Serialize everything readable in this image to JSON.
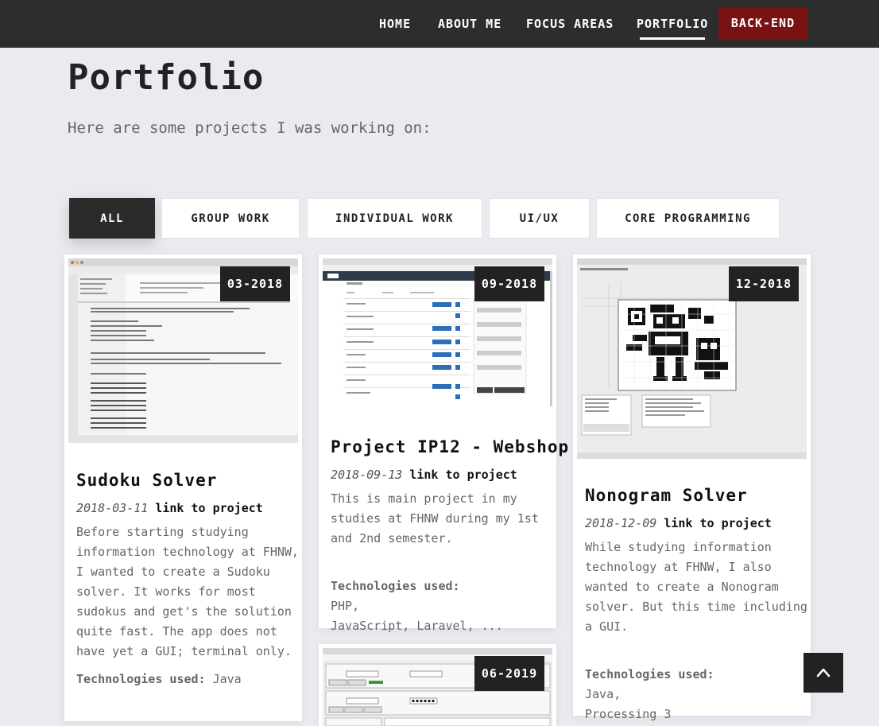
{
  "nav": {
    "home": "HOME",
    "about": "ABOUT ME",
    "focus": "FOCUS AREAS",
    "portfolio": "PORTFOLIO",
    "backend": "BACK-END"
  },
  "header": {
    "title": "Portfolio",
    "subtitle": "Here are some projects I was working on:"
  },
  "filters": [
    "ALL",
    "GROUP WORK",
    "INDIVIDUAL WORK",
    "UI/UX",
    "CORE PROGRAMMING"
  ],
  "projects": [
    {
      "badge": "03-2018",
      "title": "Sudoku Solver",
      "date": "2018-03-11",
      "link": "link to project",
      "desc": "Before starting studying\ninformation technology at FHNW,\nI wanted to create a Sudoku\nsolver. It works for most\nsudokus and get's the solution\nquite fast. The app does not\nhave yet a GUI; terminal only.",
      "tech_label": "Technologies used:",
      "tech": "Java"
    },
    {
      "badge": "09-2018",
      "title": "Project IP12 - Webshop",
      "date": "2018-09-13",
      "link": "link to project",
      "desc": "This is main project in my\nstudies at FHNW during my 1st\nand 2nd semester.",
      "tech_label": "Technologies used:",
      "tech": "PHP,\nJavaScript, Laravel, ..."
    },
    {
      "badge": "12-2018",
      "title": "Nonogram Solver",
      "date": "2018-12-09",
      "link": "link to project",
      "desc": "While studying information\ntechnology at FHNW, I also\nwanted to create a Nonogram\nsolver. But this time including\na GUI.",
      "tech_label": "Technologies used:",
      "tech": "Java,\nProcessing 3"
    },
    {
      "badge": "06-2019"
    }
  ],
  "colors": {
    "nav_bg": "#2d2d2d",
    "cta_bg": "#7a1214",
    "page_bg": "#eaeaf0"
  },
  "icons": {
    "to_top": "chevron-up-icon"
  }
}
